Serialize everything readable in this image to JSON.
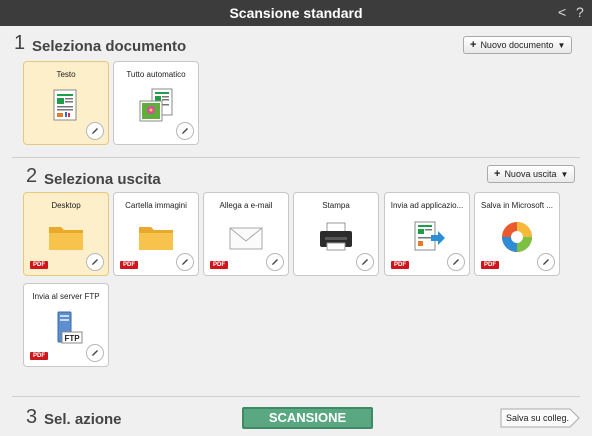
{
  "window": {
    "title": "Scansione standard",
    "back_label": "<",
    "help_label": "?"
  },
  "section1": {
    "number": "1",
    "title": "Seleziona documento",
    "add_button": "Nuovo documento",
    "cards": [
      {
        "label": "Testo",
        "icon": "text-document-icon",
        "selected": true
      },
      {
        "label": "Tutto automatico",
        "icon": "auto-document-icon",
        "selected": false
      }
    ]
  },
  "section2": {
    "number": "2",
    "title": "Seleziona uscita",
    "add_button": "Nuova uscita",
    "pdf_badge": "PDF",
    "cards": [
      {
        "label": "Desktop",
        "icon": "folder-icon",
        "pdf": true,
        "selected": true
      },
      {
        "label": "Cartella immagini",
        "icon": "folder-icon",
        "pdf": true,
        "selected": false
      },
      {
        "label": "Allega a e-mail",
        "icon": "envelope-icon",
        "pdf": true,
        "selected": false
      },
      {
        "label": "Stampa",
        "icon": "printer-icon",
        "pdf": false,
        "selected": false
      },
      {
        "label": "Invia ad applicazio...",
        "icon": "send-to-app-icon",
        "pdf": true,
        "selected": false
      },
      {
        "label": "Salva in Microsoft ...",
        "icon": "microsoft-app-icon",
        "pdf": true,
        "selected": false
      },
      {
        "label": "Invia al server FTP",
        "icon": "ftp-server-icon",
        "pdf": true,
        "selected": false
      }
    ]
  },
  "section3": {
    "number": "3",
    "title": "Sel. azione",
    "scan_button": "SCANSIONE",
    "save_button": "Salva su colleg."
  },
  "colors": {
    "titlebar": "#3c3c3c",
    "selected_card": "#fcefc9",
    "scan_button": "#5aa882",
    "pdf_badge": "#d0161b"
  }
}
